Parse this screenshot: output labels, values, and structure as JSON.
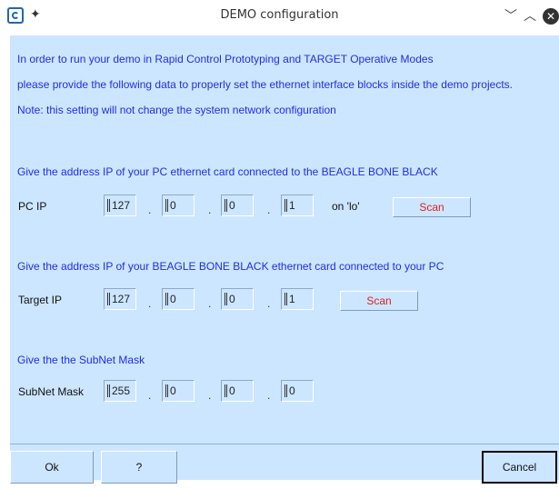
{
  "window": {
    "title": "DEMO configuration",
    "minimize_glyph": "﹀",
    "maximize_glyph": "︿",
    "close_glyph": "✕",
    "pin_glyph": "✦"
  },
  "intro": {
    "line1": "In order to run your demo in Rapid Control Prototyping and TARGET Operative Modes",
    "line2": "please provide the following data to properly set the ethernet interface blocks inside the demo projects.",
    "line3": "Note: this setting will not change the system network configuration"
  },
  "pc": {
    "heading": "Give the address IP of your PC ethernet card connected to the BEAGLE BONE BLACK",
    "label": "PC IP",
    "octets": [
      "127",
      "0",
      "0",
      "1"
    ],
    "interface_text": "on  'lo'",
    "scan_label": "Scan"
  },
  "target": {
    "heading": "Give the address IP of your BEAGLE BONE BLACK ethernet card connected to your PC",
    "label": "Target IP",
    "octets": [
      "127",
      "0",
      "0",
      "1"
    ],
    "scan_label": "Scan"
  },
  "subnet": {
    "heading": "Give the the SubNet Mask",
    "label": "SubNet Mask",
    "octets": [
      "255",
      "0",
      "0",
      "0"
    ]
  },
  "dot_glyph": ".",
  "buttons": {
    "ok": "Ok",
    "help": "?",
    "cancel": "Cancel"
  },
  "colors": {
    "panel_bg": "#cce6ff",
    "instruction_text": "#1f2ee8",
    "scan_text": "#e0211c"
  }
}
